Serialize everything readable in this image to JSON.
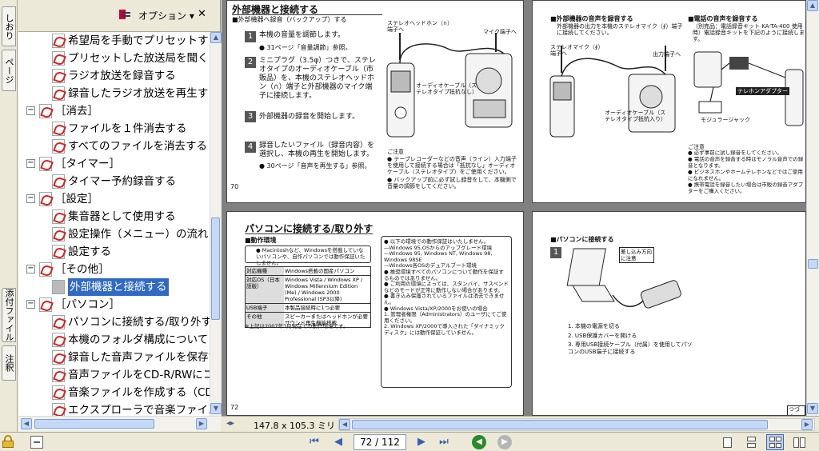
{
  "left_tabs": [
    "しおり",
    "ページ",
    "添付ファイル",
    "注釈"
  ],
  "panel": {
    "options_label": "オプション ▾",
    "close_symbol": "✕"
  },
  "tree": [
    {
      "label": "希望局を手動でプリセットする",
      "level": 2,
      "expander": "",
      "icon": "pdf"
    },
    {
      "label": "プリセットした放送局を聞く",
      "level": 2,
      "expander": "",
      "icon": "pdf"
    },
    {
      "label": "ラジオ放送を録音する",
      "level": 2,
      "expander": "",
      "icon": "pdf"
    },
    {
      "label": "録音したラジオ放送を再生す",
      "level": 2,
      "expander": "",
      "icon": "pdf"
    },
    {
      "label": "［消去］",
      "level": 1,
      "expander": "−",
      "icon": "pdf"
    },
    {
      "label": "ファイルを１件消去する",
      "level": 2,
      "expander": "",
      "icon": "pdf"
    },
    {
      "label": "すべてのファイルを消去する（フ",
      "level": 2,
      "expander": "",
      "icon": "pdf"
    },
    {
      "label": "［タイマー］",
      "level": 1,
      "expander": "−",
      "icon": "pdf"
    },
    {
      "label": "タイマー予約録音する",
      "level": 2,
      "expander": "",
      "icon": "pdf"
    },
    {
      "label": "［設定］",
      "level": 1,
      "expander": "−",
      "icon": "pdf"
    },
    {
      "label": "集音器として使用する",
      "level": 2,
      "expander": "",
      "icon": "pdf"
    },
    {
      "label": "設定操作（メニュー）の流れ",
      "level": 2,
      "expander": "",
      "icon": "pdf"
    },
    {
      "label": "設定する",
      "level": 2,
      "expander": "",
      "icon": "pdf"
    },
    {
      "label": "［その他］",
      "level": 1,
      "expander": "−",
      "icon": "pdf"
    },
    {
      "label": "外部機器と接続する",
      "level": 2,
      "expander": "",
      "icon": "doc",
      "selected": true
    },
    {
      "label": "［パソコン］",
      "level": 1,
      "expander": "−",
      "icon": "pdf"
    },
    {
      "label": "パソコンに接続する/取り外す",
      "level": 2,
      "expander": "",
      "icon": "pdf"
    },
    {
      "label": "本機のフォルダ構成について",
      "level": 2,
      "expander": "",
      "icon": "pdf"
    },
    {
      "label": "録音した音声ファイルを保存で",
      "level": 2,
      "expander": "",
      "icon": "pdf"
    },
    {
      "label": "音声ファイルをCD-R/RWにコピ",
      "level": 2,
      "expander": "",
      "icon": "pdf"
    },
    {
      "label": "音楽ファイルを作成する（CDリ",
      "level": 2,
      "expander": "",
      "icon": "pdf"
    },
    {
      "label": "エクスプローラで音楽ファイルを",
      "level": 2,
      "expander": "",
      "icon": "pdf"
    }
  ],
  "pages": {
    "p70": {
      "title": "外部機器と接続する",
      "sub": "■外部機器へ録音（バックアップ）する",
      "steps": [
        "本機の音量を調節します。",
        "ミニプラグ（3.5φ）つきで、ステレオタイプのオーディオケーブル（市販品）を、本機のステレオヘッドホン（∩）端子と外部機器のマイク端子に接続します。",
        "外部機器の録音を開始します。",
        "録音したいファイル（録音内容）を選択し、本機の再生を開始します。"
      ],
      "step_notes": [
        "● 31ページ「音量調節」参照。",
        "● 30ページ「音声を再生する」参照。"
      ],
      "callouts": [
        "ステレオヘッドホン（∩）端子へ",
        "マイク端子へ",
        "オーディオケーブル（ステレオタイプ抵抗なし）"
      ],
      "notice_title": "ご注意",
      "notice": [
        "● テープレコーダーなどの音声（ライン）入力端子を使用して接続する場合は「抵抗なし」オーディオケーブル（ステレオタイプ）をご使用ください。",
        "● バックアップ前に必ず試し録音をして、本機側で音量の調節をしてください。"
      ],
      "number": "70"
    },
    "p71": {
      "sub1": "■外部機器の音声を録音する",
      "text1": "外部機器の出力を本機のステレオマイク（∮）端子に接続してください。",
      "callouts": [
        "ステレオマイク（∮）端子へ",
        "出力端子へ",
        "オーディオケーブル（ステレオタイプ抵抗入り）"
      ],
      "sub2": "■電話の音声を録音する",
      "text2": "（別売品：電話録音キット KA-TA-400 使用時）電話録音キットを下記のように接続します。",
      "labels": [
        "テレホンアダプター",
        "モジュラージャック"
      ],
      "notice_title": "ご注意",
      "notice": [
        "● 必ず事前に試し録音をしてください。",
        "● 電話の音声を録音する時はモノラル音声での録音となります。",
        "● ビジネスホンやホームテレホンなどではご使用になれません。",
        "● 携帯電話を録音したい場合は市販の録音アダプターをご購入ください。"
      ]
    },
    "p72": {
      "title": "パソコンに接続する/取り外す",
      "sub": "■動作環境",
      "memo": "● Macintoshなど、Windowsを搭載していないパソコンや、自作パソコンでは動作保証いたしません。",
      "table": [
        [
          "対応機種",
          "Windows搭載の国産パソコン"
        ],
        [
          "対応OS（日本語版）",
          "Windows Vista / Windows XP / Windows Millennium Edition (Me) / Windows 2000 Professional (SP3以降)"
        ],
        [
          "USB端子",
          "本製品接続時に1つ必要"
        ],
        [
          "その他",
          "スピーカーまたはヘッドホンが必要 サウンド再生機能搭載"
        ]
      ],
      "footnote": "※上記は2007年3月現在での動作環境です。",
      "right_notes": [
        "● 以下の環境での動作保証はいたしません。",
        "—Windows 95,OSからのアップグレード環境",
        "—Windows 95, Windows NT, Windows 98, Windows 98SE",
        "—Windows各OSのデュアルブート環境",
        "● 推奨環境すべてのパソコンについて動作を保証するものではありません。",
        "● ご利用の環境によっては、スタンバイ、サスペンドなどのモードが正常に動作しない場合があります。",
        "● 書き込み保護されているファイルは消去できません。",
        "● Windows Vista/XP/2000をお使いの場合",
        "1. 管理者権限（Administrators）のユーザにてご使用ください。",
        "2. Windows XP/2000で導入された「ダイナミックディスク」には動作保証していません。"
      ],
      "number": "72"
    },
    "p73": {
      "sub": "■パソコンに接続する",
      "callout": "差し込み方向に注意",
      "steps": [
        "1. 本機の電源を切る",
        "2. USB保護カバーを開ける",
        "3. 専用USB接続ケーブル（付属）を使用してパソコンのUSB端子に接続する"
      ],
      "corner": "つづく"
    }
  },
  "page_size": "147.8 x 105.3 ミリ",
  "nav": {
    "first": "⏮",
    "prev": "◀",
    "page_value": "72 / 112",
    "next": "▶",
    "last": "⏭",
    "back": "◀",
    "forward": "▶"
  },
  "colors": {
    "selection": "#316ac5",
    "chrome": "#ece9d8",
    "canvas": "#808080",
    "nav_blue": "#3a5fb5",
    "nav_green": "#2a8a2a"
  }
}
